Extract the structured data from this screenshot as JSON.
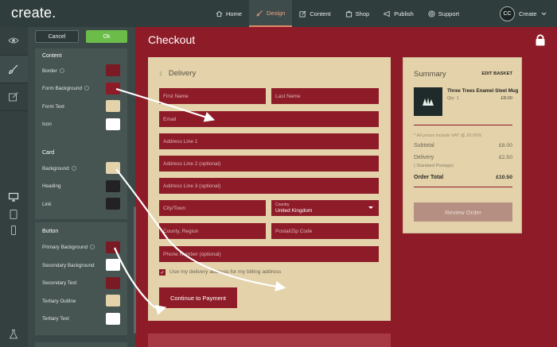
{
  "app": {
    "logo": "create."
  },
  "nav": [
    {
      "label": "Home",
      "icon": "home-icon"
    },
    {
      "label": "Design",
      "icon": "paintbrush-icon",
      "active": true
    },
    {
      "label": "Content",
      "icon": "edit-icon"
    },
    {
      "label": "Shop",
      "icon": "bag-icon"
    },
    {
      "label": "Publish",
      "icon": "megaphone-icon"
    },
    {
      "label": "Support",
      "icon": "lifebuoy-icon"
    }
  ],
  "user": {
    "initials": "CC",
    "label": "Create"
  },
  "panel": {
    "cancel": "Cancel",
    "ok": "Ok",
    "content": {
      "title": "Content",
      "rows": [
        {
          "label": "Border",
          "info": true,
          "color": "#7a1a24"
        },
        {
          "label": "Form Background",
          "info": true,
          "color": "#8e1c28"
        },
        {
          "label": "Form Text",
          "info": false,
          "color": "#e3d2aa"
        },
        {
          "label": "Icon",
          "info": false,
          "color": "#ffffff"
        }
      ]
    },
    "card": {
      "title": "Card",
      "rows": [
        {
          "label": "Background",
          "info": true,
          "color": "#e3d2aa"
        },
        {
          "label": "Heading",
          "info": false,
          "color": "#222222"
        },
        {
          "label": "Link",
          "info": false,
          "color": "#222222"
        }
      ]
    },
    "button": {
      "title": "Button",
      "rows": [
        {
          "label": "Primary Background",
          "info": true,
          "color": "#7a1a24"
        },
        {
          "label": "Secondary Background",
          "info": false,
          "color": "#ffffff"
        },
        {
          "label": "Secondary Text",
          "info": false,
          "color": "#7a1a24"
        },
        {
          "label": "Tertiary Outline",
          "info": false,
          "color": "#e3d2aa"
        },
        {
          "label": "Tertiary Text",
          "info": false,
          "color": "#ffffff"
        }
      ]
    }
  },
  "page": {
    "title": "Checkout"
  },
  "delivery": {
    "step": "1",
    "title": "Delivery",
    "fields": {
      "first_name": "First Name",
      "last_name": "Last Name",
      "email": "Email",
      "address1": "Address Line 1",
      "address2": "Address Line 2 (optional)",
      "address3": "Address Line 3 (optional)",
      "city": "City/Town",
      "country_label": "Country",
      "country_value": "United Kingdom",
      "county": "County, Region",
      "postcode": "Postal/Zip Code",
      "phone": "Phone Number (optional)"
    },
    "billing_checkbox": "Use my delivery address for my billing address",
    "continue": "Continue to Payment"
  },
  "summary": {
    "title": "Summary",
    "edit": "EDIT BASKET",
    "product_name": "Three Trees Enamel Steel Mug",
    "qty": "Qty: 1",
    "product_price": "£8.00",
    "vat_note": "* All prices include VAT @ 20.00%",
    "subtotal_label": "Subtotal",
    "subtotal": "£8.00",
    "delivery_label": "Delivery",
    "delivery_method": "( Standard Postage)",
    "delivery": "£2.50",
    "total_label": "Order Total",
    "total": "£10.50",
    "review": "Review Order"
  },
  "colors": {
    "brand": "#8e1c28",
    "card": "#e3d2aa",
    "topbar": "#2f3d3c",
    "ok": "#6cbc4a"
  }
}
